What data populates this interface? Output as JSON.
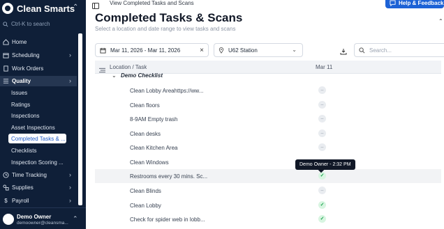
{
  "sidebar": {
    "brand": "Clean Smarts",
    "search_placeholder": "Ctrl-K to search",
    "items": [
      {
        "label": "Home"
      },
      {
        "label": "Scheduling"
      },
      {
        "label": "Work Orders"
      },
      {
        "label": "Quality"
      },
      {
        "label": "Time Tracking"
      },
      {
        "label": "Supplies"
      },
      {
        "label": "Payroll"
      }
    ],
    "quality_sub": [
      {
        "label": "Issues"
      },
      {
        "label": "Ratings"
      },
      {
        "label": "Inspections"
      },
      {
        "label": "Asset Inspections"
      },
      {
        "label": "Completed Tasks & ..."
      },
      {
        "label": "Checklists"
      },
      {
        "label": "Inspection Scoring ..."
      }
    ],
    "user": {
      "name": "Demo Owner",
      "email": "demoowner@cleansma..."
    }
  },
  "header": {
    "breadcrumb": "View Completed Tasks and Scans",
    "help_label": "Help & Feedback",
    "title": "Completed Tasks & Scans",
    "subtitle": "Select a location and date range to view tasks and scans"
  },
  "filters": {
    "date_range": "Mar 11, 2026 - Mar 11, 2026",
    "location": "U62 Station",
    "search_placeholder": "Search..."
  },
  "table": {
    "col_location": "Location / Task",
    "col_date": "Mar 11",
    "group": "Demo Checklist",
    "rows": [
      {
        "task": "Clean Lobby Areahttps://ww...",
        "status": "pending"
      },
      {
        "task": "Clean floors",
        "status": "pending"
      },
      {
        "task": "8-9AM Empty trash",
        "status": "pending"
      },
      {
        "task": "Clean desks",
        "status": "pending"
      },
      {
        "task": "Clean Kitchen Area",
        "status": "pending"
      },
      {
        "task": "Clean Windows",
        "status": "none"
      },
      {
        "task": "Restrooms every 30 mins. Sc...",
        "status": "done"
      },
      {
        "task": "Clean Blinds",
        "status": "pending"
      },
      {
        "task": "Clean Lobby",
        "status": "done"
      },
      {
        "task": "Check for spider web in lobb...",
        "status": "done"
      }
    ],
    "tooltip": "Demo Owner - 2:32 PM"
  },
  "colors": {
    "sidebar_bg": "#0f1f38",
    "accent": "#1c62d6",
    "done": "#16a34a"
  }
}
